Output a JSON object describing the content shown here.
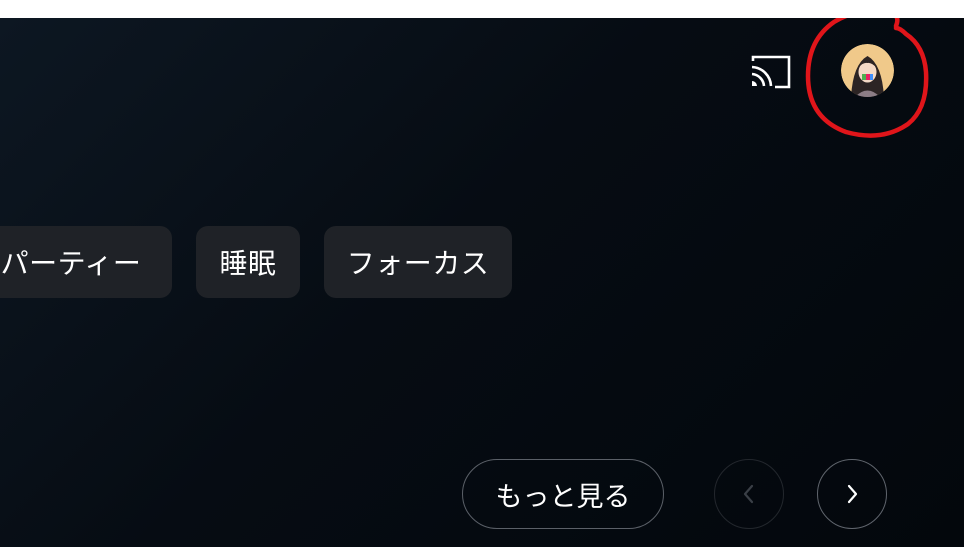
{
  "header": {
    "cast_icon": "cast-icon",
    "avatar_icon": "user-avatar",
    "annotation_color": "#e0151a"
  },
  "chips": [
    {
      "label": "パーティー"
    },
    {
      "label": "睡眠"
    },
    {
      "label": "フォーカス"
    }
  ],
  "actions": {
    "more_label": "もっと見る",
    "prev_icon": "chevron-left-icon",
    "next_icon": "chevron-right-icon"
  },
  "colors": {
    "background": "#060c13",
    "chip_background": "#1f2227",
    "text": "#ffffff"
  }
}
